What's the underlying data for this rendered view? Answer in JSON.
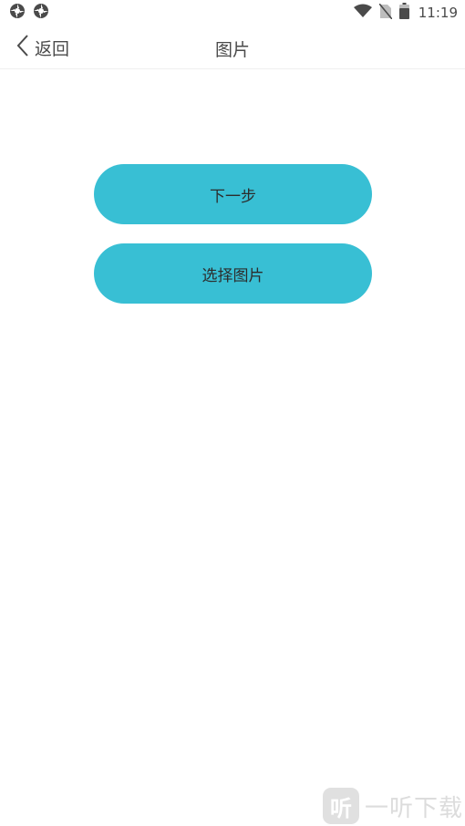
{
  "status_bar": {
    "time": "11:19",
    "left_icons": [
      "aperture-icon",
      "aperture-icon"
    ],
    "right_icons": [
      "wifi-icon",
      "no-sim-icon",
      "battery-icon"
    ]
  },
  "nav": {
    "back_label": "返回",
    "title": "图片"
  },
  "buttons": {
    "next_label": "下一步",
    "choose_label": "选择图片"
  },
  "watermark": {
    "logo_glyph": "听",
    "text": "一听下载"
  },
  "colors": {
    "accent": "#38bfd4",
    "text": "#4a4a4a",
    "background": "#ffffff"
  }
}
